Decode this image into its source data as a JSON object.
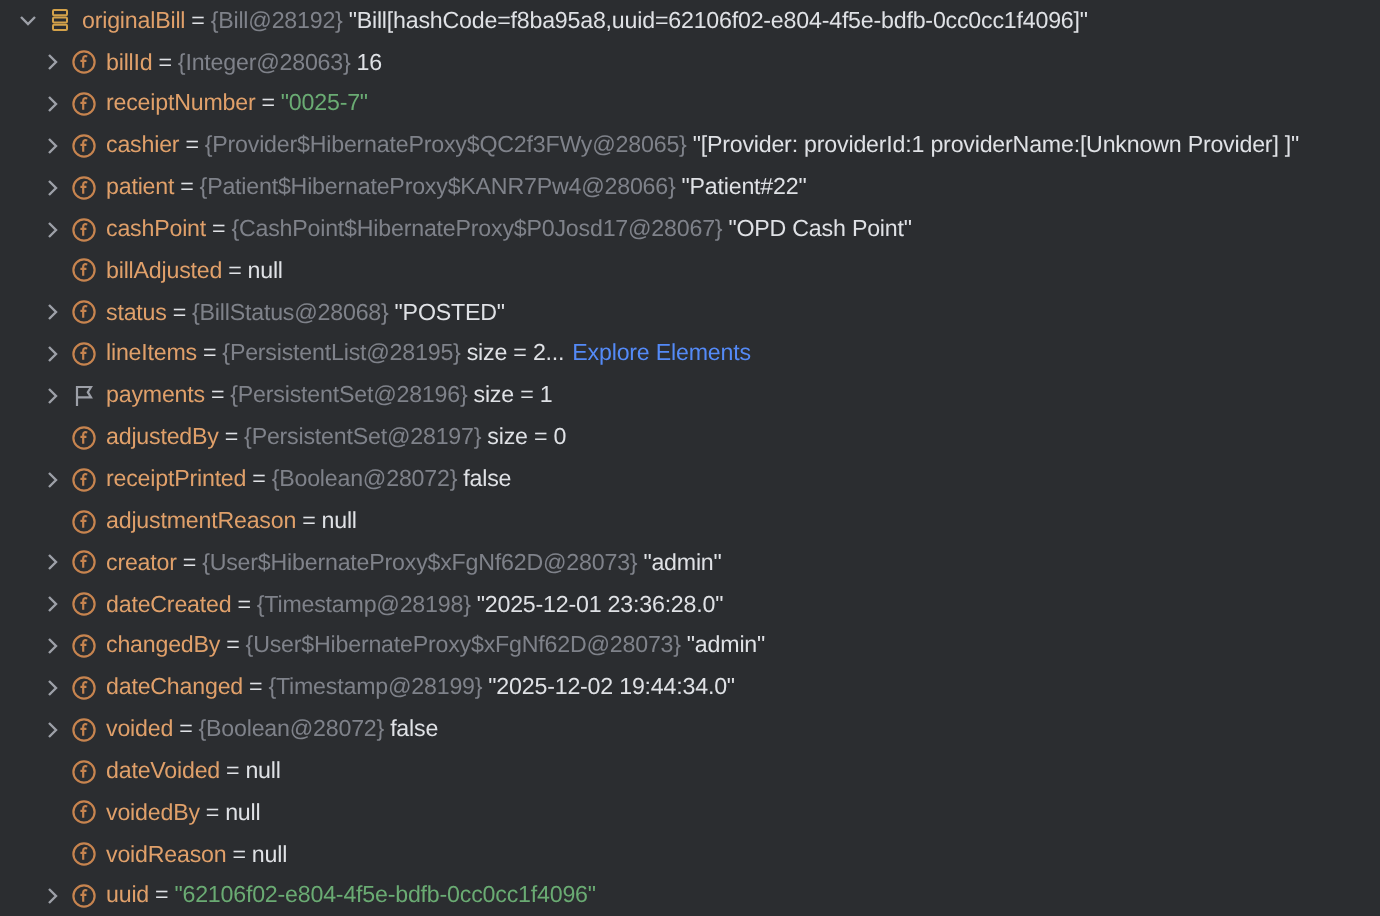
{
  "root": {
    "kind": "root",
    "expanded": true,
    "name": "originalBill",
    "eq": "=",
    "type": "{Bill@28192}",
    "value": "\"Bill[hashCode=f8ba95a8,uuid=62106f02-e804-4f5e-bdfb-0cc0cc1f4096]\""
  },
  "children": [
    {
      "kind": "field",
      "expanded": false,
      "name": "billId",
      "eq": "=",
      "type": "{Integer@28063}",
      "value": "16"
    },
    {
      "kind": "string-field",
      "expanded": false,
      "name": "receiptNumber",
      "eq": "=",
      "value": "\"0025-7\""
    },
    {
      "kind": "field",
      "expanded": false,
      "name": "cashier",
      "eq": "=",
      "type": "{Provider$HibernateProxy$QC2f3FWy@28065}",
      "value": "\"[Provider: providerId:1 providerName:[Unknown Provider] ]\""
    },
    {
      "kind": "field",
      "expanded": false,
      "name": "patient",
      "eq": "=",
      "type": "{Patient$HibernateProxy$KANR7Pw4@28066}",
      "value": "\"Patient#22\""
    },
    {
      "kind": "field",
      "expanded": false,
      "name": "cashPoint",
      "eq": "=",
      "type": "{CashPoint$HibernateProxy$P0Josd17@28067}",
      "value": "\"OPD Cash Point\""
    },
    {
      "kind": "leaf-field",
      "name": "billAdjusted",
      "eq": "=",
      "value": "null"
    },
    {
      "kind": "field",
      "expanded": false,
      "name": "status",
      "eq": "=",
      "type": "{BillStatus@28068}",
      "value": "\"POSTED\""
    },
    {
      "kind": "field",
      "expanded": false,
      "name": "lineItems",
      "eq": "=",
      "type": "{PersistentList@28195}",
      "value": "size = 2...",
      "link": "Explore Elements"
    },
    {
      "kind": "flag-field",
      "expanded": false,
      "name": "payments",
      "eq": "=",
      "type": "{PersistentSet@28196}",
      "value": "size = 1"
    },
    {
      "kind": "leaf-field",
      "name": "adjustedBy",
      "eq": "=",
      "type": "{PersistentSet@28197}",
      "value": "size = 0"
    },
    {
      "kind": "field",
      "expanded": false,
      "name": "receiptPrinted",
      "eq": "=",
      "type": "{Boolean@28072}",
      "value": "false"
    },
    {
      "kind": "leaf-field",
      "name": "adjustmentReason",
      "eq": "=",
      "value": "null"
    },
    {
      "kind": "field",
      "expanded": false,
      "name": "creator",
      "eq": "=",
      "type": "{User$HibernateProxy$xFgNf62D@28073}",
      "value": "\"admin\""
    },
    {
      "kind": "field",
      "expanded": false,
      "name": "dateCreated",
      "eq": "=",
      "type": "{Timestamp@28198}",
      "value": "\"2025-12-01 23:36:28.0\""
    },
    {
      "kind": "field",
      "expanded": false,
      "name": "changedBy",
      "eq": "=",
      "type": "{User$HibernateProxy$xFgNf62D@28073}",
      "value": "\"admin\""
    },
    {
      "kind": "field",
      "expanded": false,
      "name": "dateChanged",
      "eq": "=",
      "type": "{Timestamp@28199}",
      "value": "\"2025-12-02 19:44:34.0\""
    },
    {
      "kind": "field",
      "expanded": false,
      "name": "voided",
      "eq": "=",
      "type": "{Boolean@28072}",
      "value": "false"
    },
    {
      "kind": "leaf-field",
      "name": "dateVoided",
      "eq": "=",
      "value": "null"
    },
    {
      "kind": "leaf-field",
      "name": "voidedBy",
      "eq": "=",
      "value": "null"
    },
    {
      "kind": "leaf-field",
      "name": "voidReason",
      "eq": "=",
      "value": "null"
    },
    {
      "kind": "string-field",
      "expanded": false,
      "name": "uuid",
      "eq": "=",
      "value": "\"62106f02-e804-4f5e-bdfb-0cc0cc1f4096\""
    }
  ]
}
